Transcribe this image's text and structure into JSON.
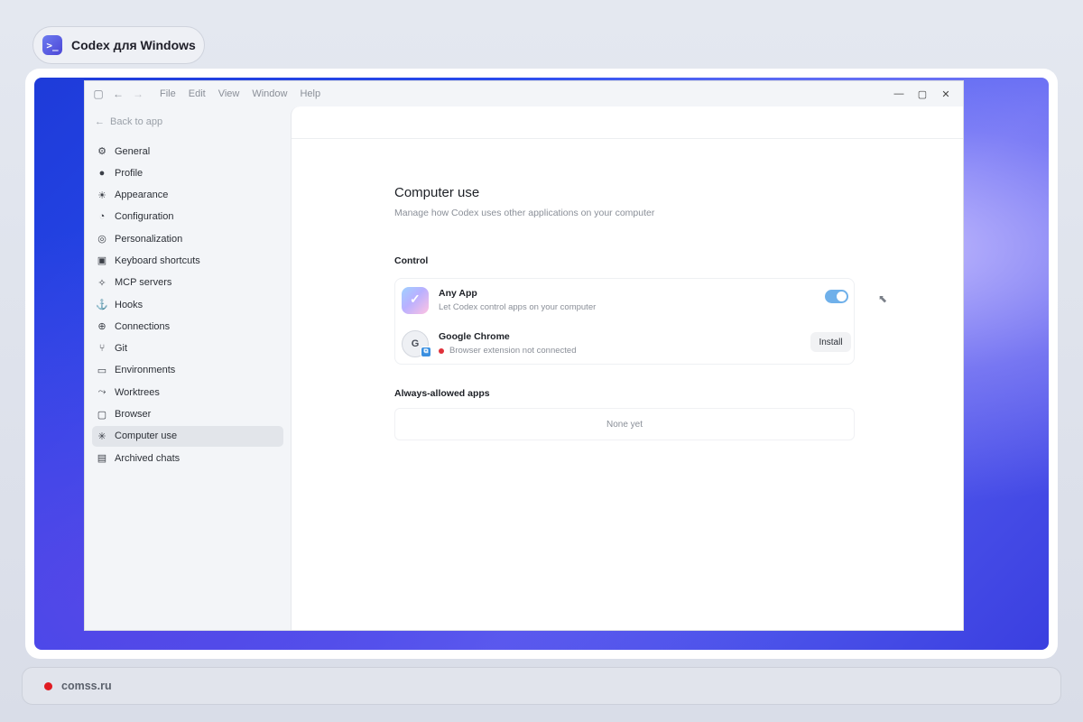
{
  "header": {
    "title": "Codex для Windows",
    "app_icon": "terminal-badge-icon"
  },
  "window": {
    "menu": [
      "File",
      "Edit",
      "View",
      "Window",
      "Help"
    ],
    "controls": [
      "minimize",
      "maximize",
      "close"
    ]
  },
  "sidebar": {
    "back_label": "Back to app",
    "items": [
      {
        "label": "General",
        "icon": "gear-icon"
      },
      {
        "label": "Profile",
        "icon": "user-icon"
      },
      {
        "label": "Appearance",
        "icon": "sun-icon"
      },
      {
        "label": "Configuration",
        "icon": "config-icon"
      },
      {
        "label": "Personalization",
        "icon": "personalization-icon"
      },
      {
        "label": "Keyboard shortcuts",
        "icon": "keyboard-icon"
      },
      {
        "label": "MCP servers",
        "icon": "mcp-icon"
      },
      {
        "label": "Hooks",
        "icon": "anchor-icon"
      },
      {
        "label": "Connections",
        "icon": "globe-icon"
      },
      {
        "label": "Git",
        "icon": "branch-icon"
      },
      {
        "label": "Environments",
        "icon": "monitor-icon"
      },
      {
        "label": "Worktrees",
        "icon": "worktree-icon"
      },
      {
        "label": "Browser",
        "icon": "browser-icon"
      },
      {
        "label": "Computer use",
        "icon": "pointer-icon",
        "active": true
      },
      {
        "label": "Archived chats",
        "icon": "archive-icon"
      }
    ]
  },
  "main": {
    "title": "Computer use",
    "subtitle": "Manage how Codex uses other applications on your computer",
    "control_label": "Control",
    "rows": [
      {
        "title": "Any App",
        "desc": "Let Codex control apps on your computer",
        "toggle_on": true
      },
      {
        "title": "Google Chrome",
        "desc": "Browser extension not connected",
        "status_color": "#e0303a",
        "button_label": "Install"
      }
    ],
    "allowed_label": "Always-allowed apps",
    "allowed_empty": "None yet"
  },
  "footer": {
    "text": "comss.ru",
    "dot_color": "#e01b22"
  },
  "colors": {
    "accent_toggle": "#6fb0ea",
    "wallpaper_blue": "#2a4df0"
  }
}
